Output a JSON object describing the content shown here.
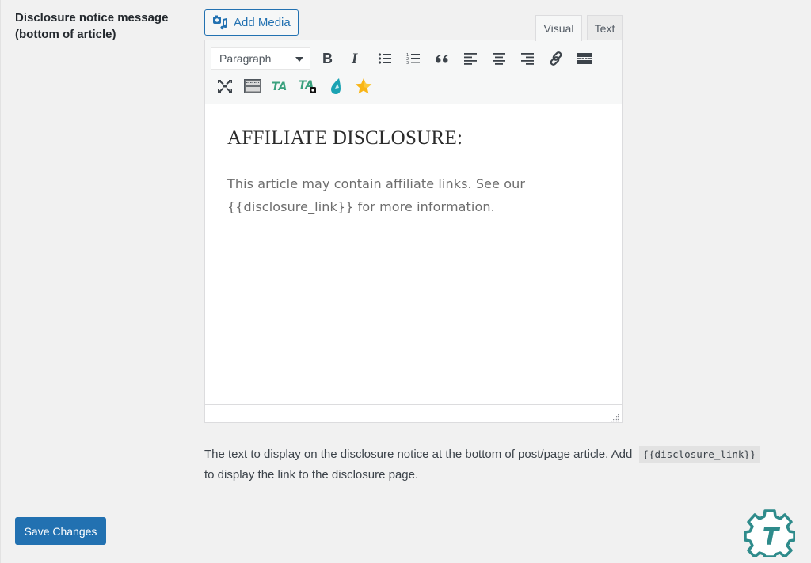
{
  "field": {
    "label": "Disclosure notice message (bottom of article)"
  },
  "media": {
    "add_media_label": "Add Media",
    "icon": "add-media-icon"
  },
  "editor": {
    "tabs": [
      {
        "label": "Visual",
        "active": true
      },
      {
        "label": "Text",
        "active": false
      }
    ],
    "format_select": {
      "selected": "Paragraph"
    },
    "toolbar_row1": [
      {
        "name": "bold-icon",
        "title": "Bold"
      },
      {
        "name": "italic-icon",
        "title": "Italic"
      },
      {
        "name": "bulleted-list-icon",
        "title": "Bulleted list"
      },
      {
        "name": "numbered-list-icon",
        "title": "Numbered list"
      },
      {
        "name": "blockquote-icon",
        "title": "Blockquote"
      },
      {
        "name": "align-left-icon",
        "title": "Align left"
      },
      {
        "name": "align-center-icon",
        "title": "Align center"
      },
      {
        "name": "align-right-icon",
        "title": "Align right"
      },
      {
        "name": "link-icon",
        "title": "Insert/edit link"
      },
      {
        "name": "read-more-icon",
        "title": "Insert Read More tag"
      }
    ],
    "toolbar_row2": [
      {
        "name": "fullscreen-icon",
        "title": "Fullscreen"
      },
      {
        "name": "toolbar-toggle-icon",
        "title": "Toolbar Toggle"
      },
      {
        "name": "thirstyaffiliates-link-icon",
        "title": "ThirstyAffiliates link",
        "text": "TA"
      },
      {
        "name": "thirstyaffiliates-quick-add-icon",
        "title": "ThirstyAffiliates quick add",
        "text": "TA"
      },
      {
        "name": "droplet-icon",
        "title": "Droplet"
      },
      {
        "name": "star-icon",
        "title": "Star"
      }
    ],
    "content": {
      "heading": "AFFILIATE DISCLOSURE:",
      "paragraph": "This article may contain affiliate links. See our {{disclosure_link}} for more information."
    }
  },
  "description": {
    "text_before": "The text to display on the disclosure notice at the bottom of post/page article. Add",
    "code": "{{disclosure_link}}",
    "text_after": "to display the link to the disclosure page."
  },
  "actions": {
    "save_label": "Save Changes"
  },
  "brand": {
    "logo_letter": "T",
    "logo_color": "#2e8b8b"
  },
  "colors": {
    "accent": "#2271b1",
    "ta_green": "#3aa17e",
    "droplet": "#1ba3b3",
    "star": "#f9b516"
  }
}
